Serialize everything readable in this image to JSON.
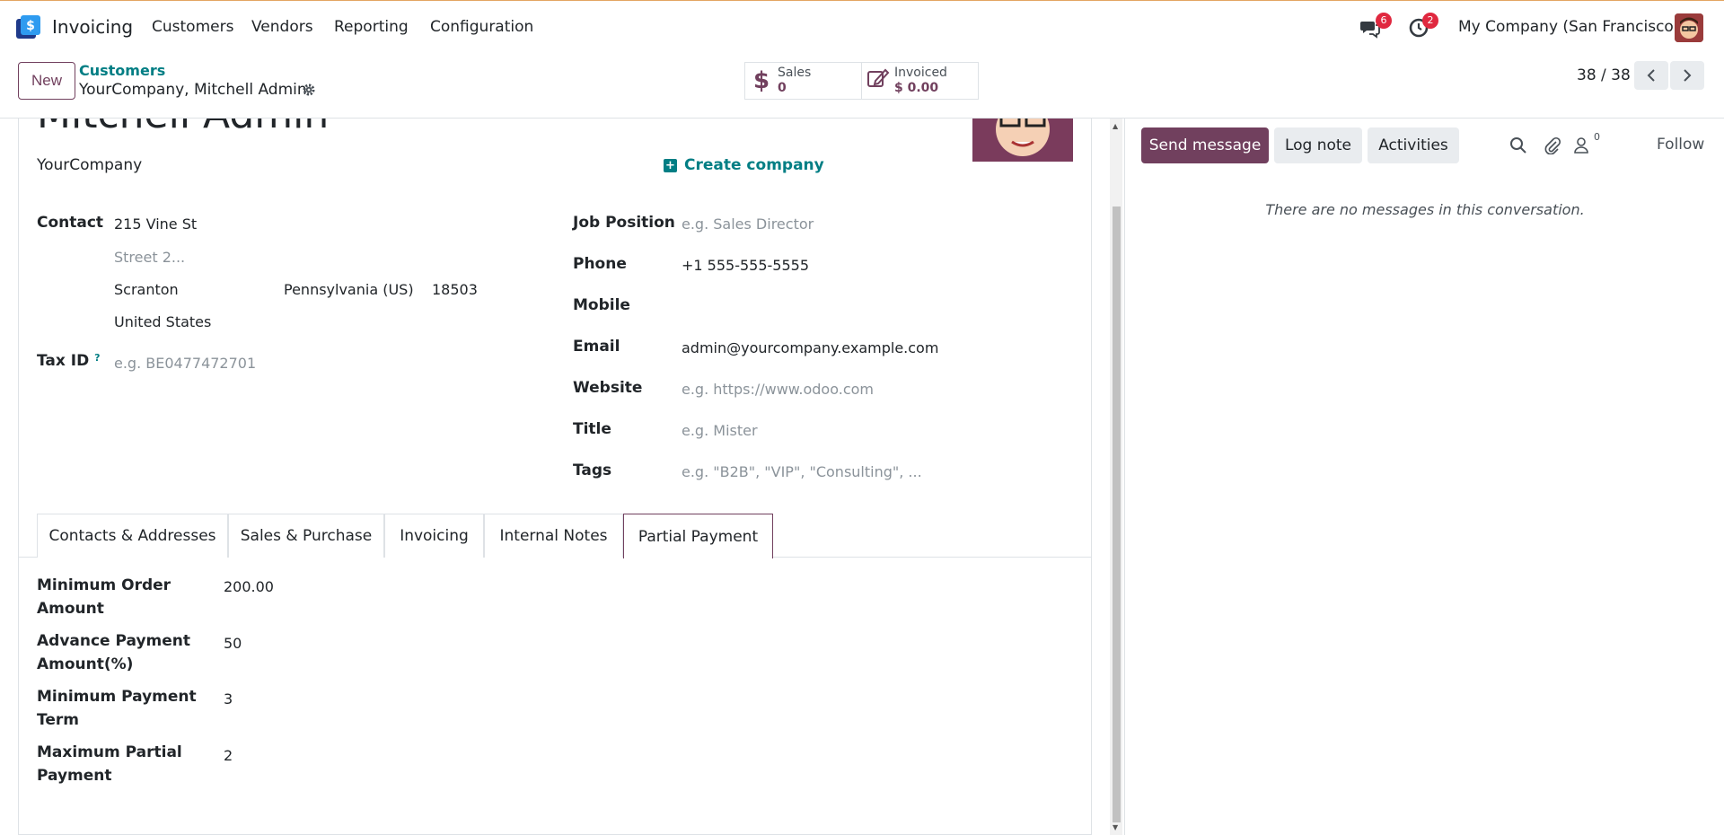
{
  "topnav": {
    "app_name": "Invoicing",
    "menus": [
      "Customers",
      "Vendors",
      "Reporting",
      "Configuration"
    ],
    "messages_badge": "6",
    "activities_badge": "2",
    "company": "My Company (San Francisco)"
  },
  "control_panel": {
    "new_label": "New",
    "breadcrumb_parent": "Customers",
    "breadcrumb_current": "YourCompany, Mitchell Admin",
    "stat_sales_label": "Sales",
    "stat_sales_value": "0",
    "stat_invoiced_label": "Invoiced",
    "stat_invoiced_value": "$ 0.00",
    "pager": "38 / 38"
  },
  "form": {
    "name": "Mitchell Admin",
    "company_name": "YourCompany",
    "create_company": "Create company",
    "contact_label": "Contact",
    "street": "215 Vine St",
    "street2_placeholder": "Street 2...",
    "city": "Scranton",
    "state": "Pennsylvania (US)",
    "zip": "18503",
    "country": "United States",
    "tax_id_label": "Tax ID",
    "tax_id_help": "?",
    "tax_id_placeholder": "e.g. BE0477472701",
    "job_position_label": "Job Position",
    "job_position_placeholder": "e.g. Sales Director",
    "phone_label": "Phone",
    "phone": "+1 555-555-5555",
    "mobile_label": "Mobile",
    "email_label": "Email",
    "email": "admin@yourcompany.example.com",
    "website_label": "Website",
    "website_placeholder": "e.g. https://www.odoo.com",
    "title_label": "Title",
    "title_placeholder": "e.g. Mister",
    "tags_label": "Tags",
    "tags_placeholder": "e.g. \"B2B\", \"VIP\", \"Consulting\", ..."
  },
  "tabs": [
    "Contacts & Addresses",
    "Sales & Purchase",
    "Invoicing",
    "Internal Notes",
    "Partial Payment"
  ],
  "active_tab": "Partial Payment",
  "partial_payment": [
    {
      "label": "Minimum Order Amount",
      "value": "200.00"
    },
    {
      "label": "Advance Payment Amount(%)",
      "value": "50"
    },
    {
      "label": "Minimum Payment Term",
      "value": "3"
    },
    {
      "label": "Maximum Partial Payment",
      "value": "2"
    }
  ],
  "chatter": {
    "send_message": "Send message",
    "log_note": "Log note",
    "activities": "Activities",
    "followers_count": "0",
    "follow": "Follow",
    "empty": "There are no messages in this conversation."
  },
  "colors": {
    "brand": "#71405e",
    "link": "#017e84",
    "badge": "#e0283f"
  }
}
